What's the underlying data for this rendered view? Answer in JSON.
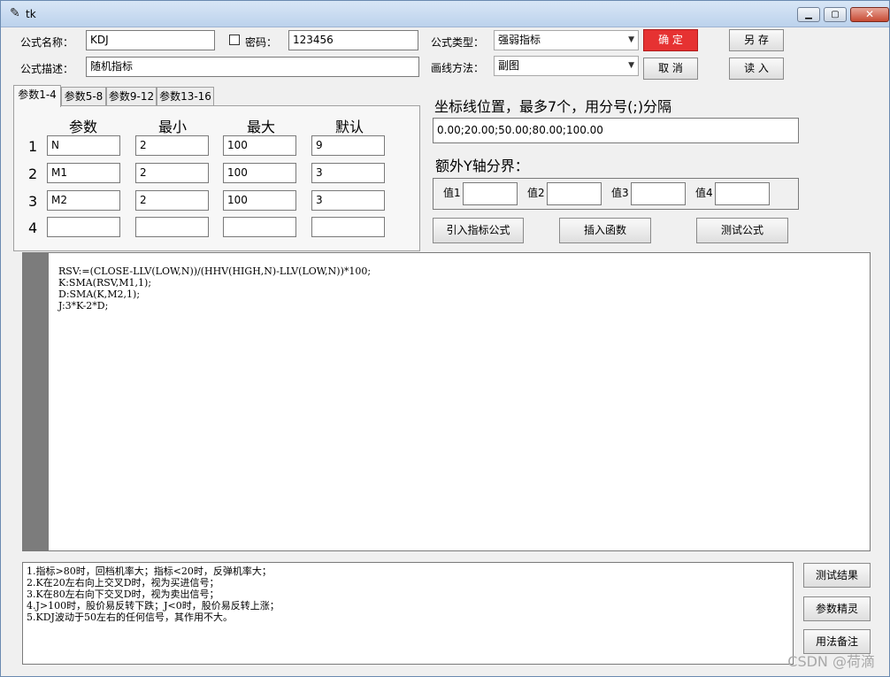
{
  "window": {
    "title": "tk",
    "icon": "feather-icon"
  },
  "form": {
    "name_label": "公式名称：",
    "name_value": "KDJ",
    "password_label": "密码：",
    "password_value": "123456",
    "desc_label": "公式描述：",
    "desc_value": "随机指标",
    "type_label": "公式类型：",
    "type_value": "强弱指标",
    "draw_label": "画线方法：",
    "draw_value": "副图"
  },
  "buttons": {
    "confirm": "确 定",
    "cancel": "取 消",
    "save_as": "另 存",
    "load": "读 入",
    "import_formula": "引入指标公式",
    "insert_function": "插入函数",
    "test_formula": "测试公式",
    "test_result": "测试结果",
    "param_wizard": "参数精灵",
    "usage_notes": "用法备注"
  },
  "tabs": [
    "参数1-4",
    "参数5-8",
    "参数9-12",
    "参数13-16"
  ],
  "params": {
    "headers": [
      "参数",
      "最小",
      "最大",
      "默认"
    ],
    "rows": [
      {
        "num": "1",
        "name": "N",
        "min": "2",
        "max": "100",
        "default": "9"
      },
      {
        "num": "2",
        "name": "M1",
        "min": "2",
        "max": "100",
        "default": "3"
      },
      {
        "num": "3",
        "name": "M2",
        "min": "2",
        "max": "100",
        "default": "3"
      },
      {
        "num": "4",
        "name": "",
        "min": "",
        "max": "",
        "default": ""
      }
    ]
  },
  "axis": {
    "label": "坐标线位置，最多7个，用分号(;)分隔",
    "value": "0.00;20.00;50.00;80.00;100.00",
    "extra_label": "额外Y轴分界：",
    "v1": "值1",
    "v2": "值2",
    "v3": "值3",
    "v4": "值4"
  },
  "code_lines": [
    "RSV:=(CLOSE-LLV(LOW,N))/(HHV(HIGH,N)-LLV(LOW,N))*100;",
    "K:SMA(RSV,M1,1);",
    "D:SMA(K,M2,1);",
    "J:3*K-2*D;"
  ],
  "notes_lines": [
    "1.指标>80时，回档机率大；指标<20时，反弹机率大；",
    "2.K在20左右向上交叉D时，视为买进信号；",
    "3.K在80左右向下交叉D时，视为卖出信号；",
    "4.J>100时，股价易反转下跌；J<0时，股价易反转上涨；",
    "5.KDJ波动于50左右的任何信号，其作用不大。"
  ],
  "watermark": "CSDN @荷滴"
}
